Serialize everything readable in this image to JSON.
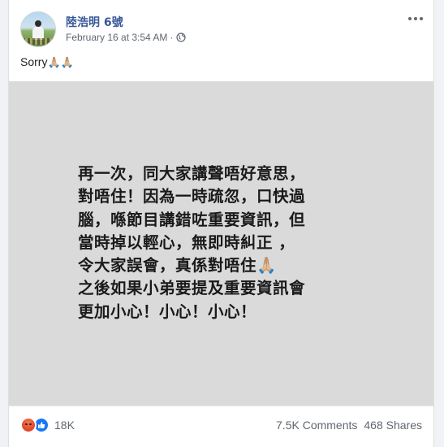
{
  "post": {
    "author": "陸浩明 6號",
    "timestamp": "February 16 at 3:54 AM",
    "separator": "·",
    "privacy_icon": "globe-icon",
    "caption": "Sorry",
    "caption_emoji": "🙏🏼🙏🏼"
  },
  "image_text": {
    "lines": [
      "再一次，同大家講聲唔好意思，",
      "對唔住！因為一時疏忽，口快過",
      "腦，喺節目講錯咗重要資訊，但",
      "當時掉以輕心，無即時糾正 ，",
      "令大家誤會，真係對唔住🙏🏼",
      "之後如果小弟要提及重要資訊會",
      "更加小心！小心！小心！"
    ]
  },
  "footer": {
    "reaction_icons": [
      "angry-icon",
      "like-icon"
    ],
    "reaction_count": "18K",
    "comments": "7.5K Comments",
    "shares": "468 Shares"
  },
  "colors": {
    "author": "#385898",
    "meta": "#606770",
    "image_bg": "#dadada",
    "like": "#1877f2",
    "angry": "#e1442a"
  }
}
